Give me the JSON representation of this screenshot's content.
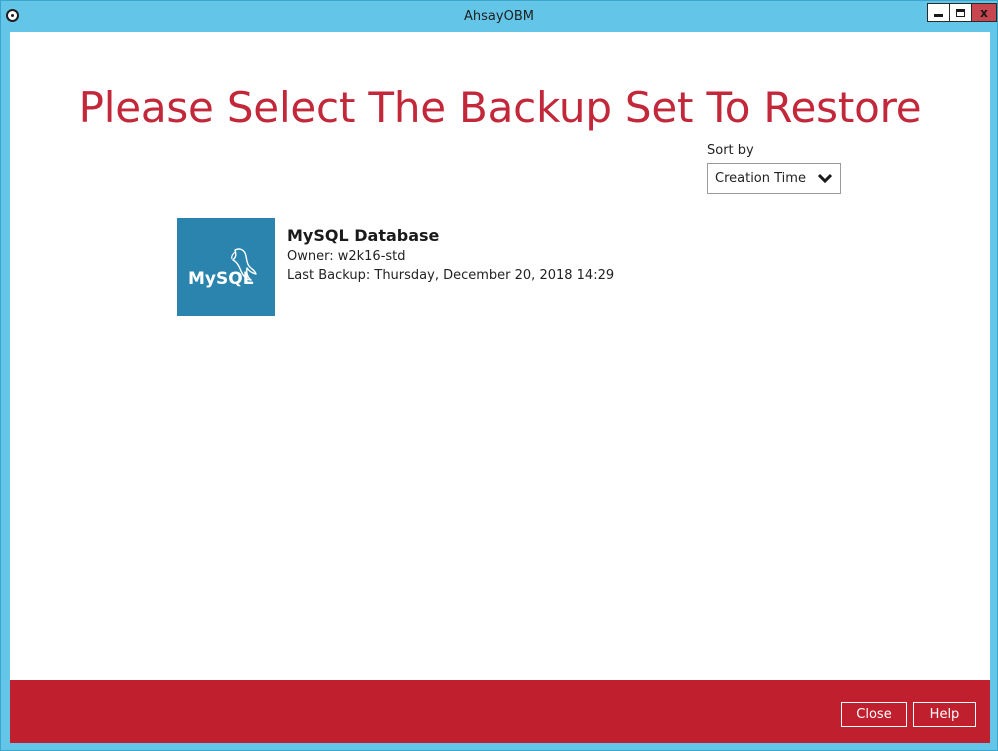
{
  "window": {
    "title": "AhsayOBM",
    "minimize_label": "",
    "maximize_label": "",
    "close_label": "x"
  },
  "main": {
    "heading": "Please Select The Backup Set To Restore",
    "sort": {
      "label": "Sort by",
      "selected": "Creation Time"
    },
    "backup_sets": [
      {
        "icon": "mysql-logo",
        "logo_text": "MySQL",
        "name": "MySQL Database",
        "owner": "Owner: w2k16-std",
        "last_backup": "Last Backup: Thursday, December 20, 2018 14:29"
      }
    ]
  },
  "footer": {
    "close_label": "Close",
    "help_label": "Help"
  },
  "colors": {
    "titlebar": "#63c6e8",
    "accent_red": "#c01f2e",
    "heading_red": "#c2273a",
    "mysql_blue": "#2a84ae"
  }
}
